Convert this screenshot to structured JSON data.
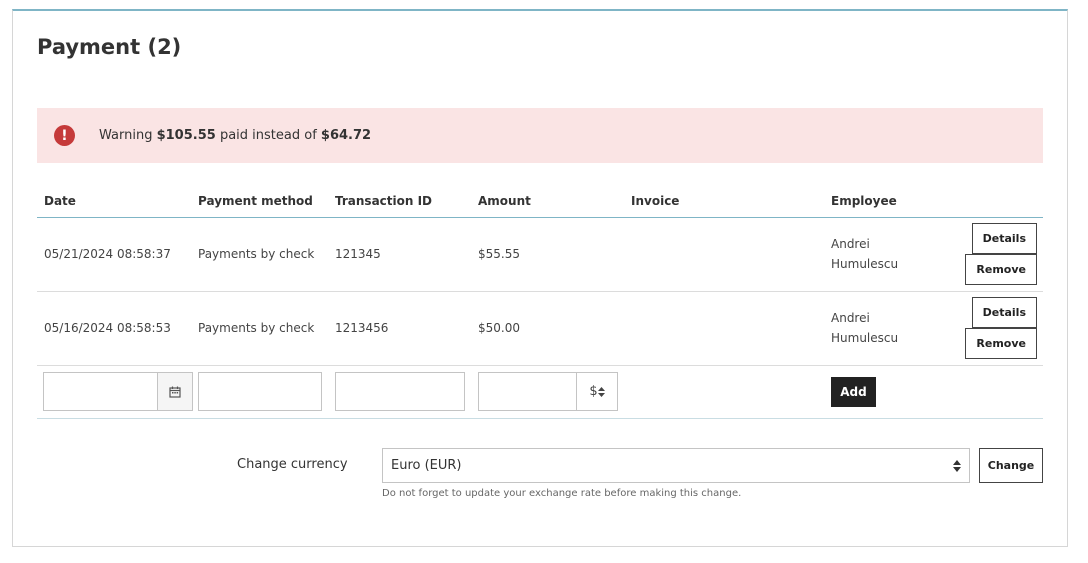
{
  "panel": {
    "title": "Payment (2)"
  },
  "warning": {
    "prefix": "Warning",
    "paid": "$105.55",
    "middle": "paid instead of",
    "expected": "$64.72",
    "icon": "exclamation-icon",
    "icon_glyph": "!",
    "color": "#c53a3a",
    "background": "#fae4e4"
  },
  "table": {
    "headers": [
      "Date",
      "Payment method",
      "Transaction ID",
      "Amount",
      "Invoice",
      "Employee"
    ],
    "rows": [
      {
        "date": "05/21/2024 08:58:37",
        "method": "Payments by check",
        "transaction_id": "121345",
        "amount": "$55.55",
        "invoice": "",
        "employee_first": "Andrei",
        "employee_last": "Humulescu",
        "details_label": "Details",
        "remove_label": "Remove"
      },
      {
        "date": "05/16/2024 08:58:53",
        "method": "Payments by check",
        "transaction_id": "1213456",
        "amount": "$50.00",
        "invoice": "",
        "employee_first": "Andrei",
        "employee_last": "Humulescu",
        "details_label": "Details",
        "remove_label": "Remove"
      }
    ],
    "add_row": {
      "date_value": "",
      "method_value": "",
      "transaction_value": "",
      "amount_value": "",
      "currency_symbol": "$",
      "add_label": "Add"
    }
  },
  "currency": {
    "label": "Change currency",
    "selected": "Euro (EUR)",
    "change_label": "Change",
    "help": "Do not forget to update your exchange rate before making this change."
  },
  "colors": {
    "accent_border": "#7fb5c6",
    "dark_button": "#222222"
  }
}
